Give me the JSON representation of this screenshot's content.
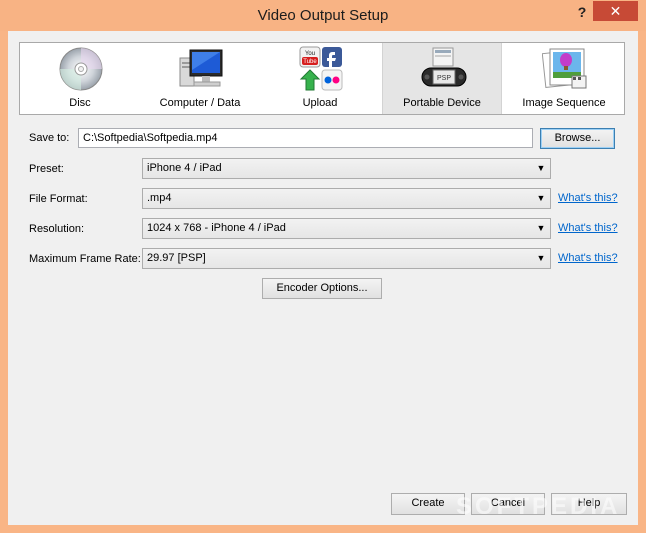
{
  "window": {
    "title": "Video Output Setup",
    "help_glyph": "?",
    "close_glyph": "✕"
  },
  "tabs": [
    {
      "label": "Disc",
      "icon": "disc-icon"
    },
    {
      "label": "Computer / Data",
      "icon": "computer-icon"
    },
    {
      "label": "Upload",
      "icon": "upload-icon"
    },
    {
      "label": "Portable Device",
      "icon": "portable-device-icon",
      "selected": true
    },
    {
      "label": "Image Sequence",
      "icon": "image-sequence-icon"
    }
  ],
  "form": {
    "save_to": {
      "label": "Save to:",
      "value": "C:\\Softpedia\\Softpedia.mp4",
      "browse": "Browse..."
    },
    "preset": {
      "label": "Preset:",
      "value": "iPhone 4 / iPad"
    },
    "file_format": {
      "label": "File Format:",
      "value": ".mp4",
      "help": "What's this?"
    },
    "resolution": {
      "label": "Resolution:",
      "value": "1024 x 768 - iPhone 4 / iPad",
      "help": "What's this?"
    },
    "frame_rate": {
      "label": "Maximum Frame Rate:",
      "value": "29.97 [PSP]",
      "help": "What's this?"
    },
    "encoder_options": "Encoder Options..."
  },
  "footer": {
    "create": "Create",
    "cancel": "Cancel",
    "help": "Help"
  },
  "icons": {
    "youtube_top": "You",
    "youtube_bottom": "Tube",
    "psp_text": "PSP"
  },
  "watermark": "SOFTPEDIA"
}
